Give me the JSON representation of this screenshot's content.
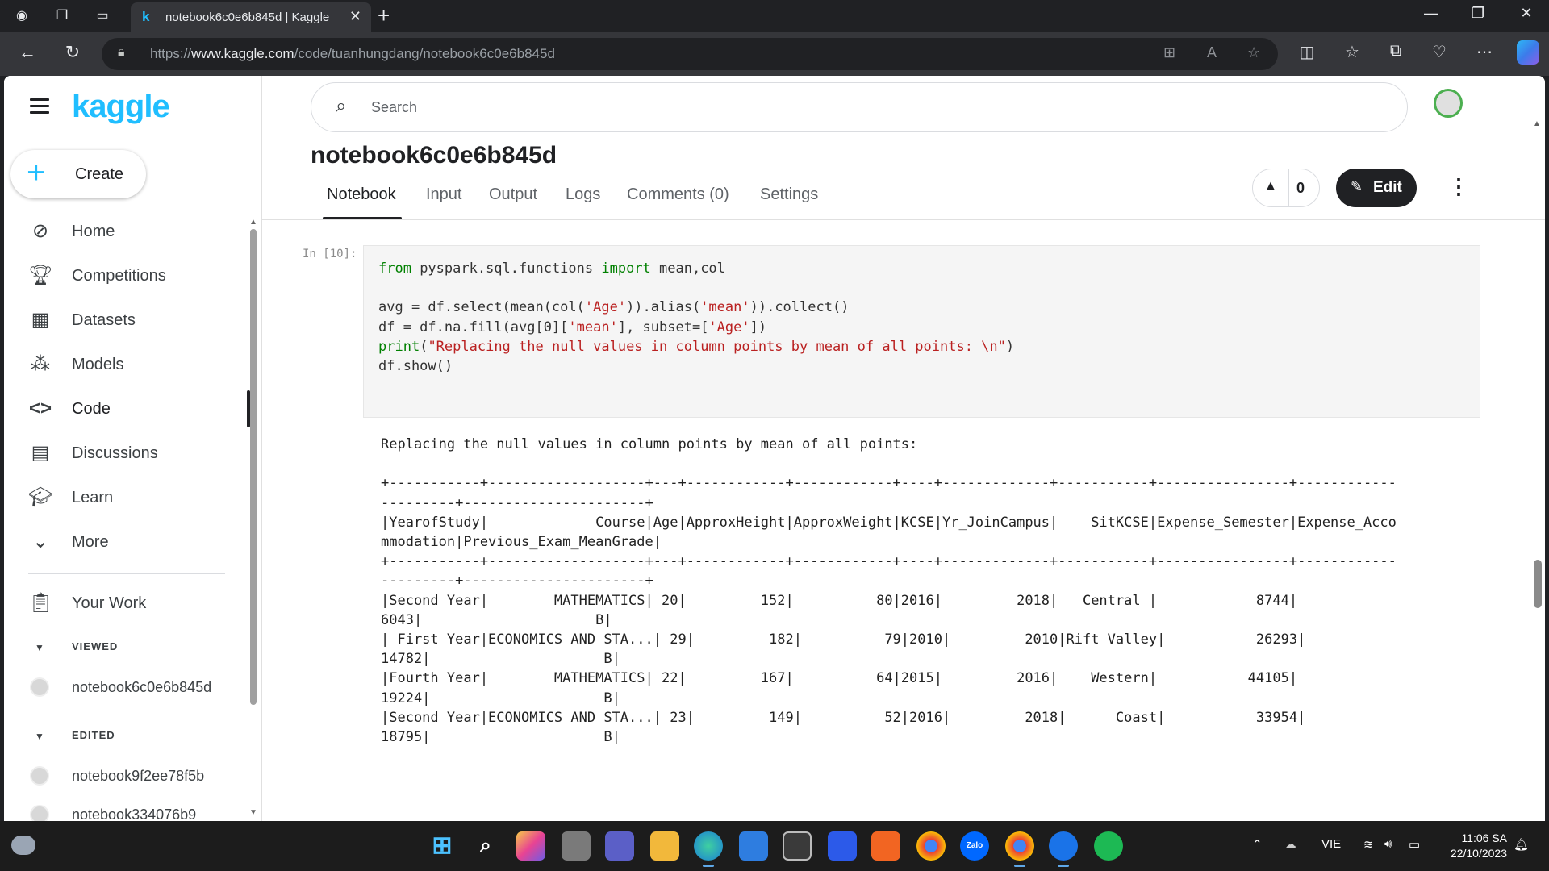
{
  "browser": {
    "tab_title": "notebook6c0e6b845d | Kaggle",
    "tab_favicon": "k",
    "url_prefix": "https://",
    "url_host": "www.kaggle.com",
    "url_path": "/code/tuanhungdang/notebook6c0e6b845d"
  },
  "sidebar": {
    "logo": "kaggle",
    "create_label": "Create",
    "nav": [
      {
        "label": "Home",
        "icon": "compass-icon"
      },
      {
        "label": "Competitions",
        "icon": "trophy-icon"
      },
      {
        "label": "Datasets",
        "icon": "table-icon"
      },
      {
        "label": "Models",
        "icon": "models-icon"
      },
      {
        "label": "Code",
        "icon": "code-icon"
      },
      {
        "label": "Discussions",
        "icon": "discussions-icon"
      },
      {
        "label": "Learn",
        "icon": "graduation-cap-icon"
      },
      {
        "label": "More",
        "icon": "chevron-down-icon"
      }
    ],
    "your_work": "Your Work",
    "viewed_header": "VIEWED",
    "viewed_item": "notebook6c0e6b845d",
    "edited_header": "EDITED",
    "edited_items": [
      "notebook9f2ee78f5b",
      "notebook334076b9"
    ]
  },
  "main": {
    "search_placeholder": "Search",
    "title": "notebook6c0e6b845d",
    "tabs": [
      "Notebook",
      "Input",
      "Output",
      "Logs",
      "Comments (0)",
      "Settings"
    ],
    "vote_count": "0",
    "edit_label": "Edit"
  },
  "cell": {
    "prompt": "In [10]:",
    "code_lines": [
      "from pyspark.sql.functions import mean,col",
      "",
      "avg = df.select(mean(col('Age')).alias('mean')).collect()",
      "df = df.na.fill(avg[0]['mean'], subset=['Age'])",
      "print(\"Replacing the null values in column points by mean of all points: \\n\")",
      "df.show()"
    ],
    "output": "Replacing the null values in column points by mean of all points: \n\n+-----------+-------------------+---+------------+------------+----+-------------+-----------+----------------+------------\n---------+----------------------+\n|YearofStudy|             Course|Age|ApproxHeight|ApproxWeight|KCSE|Yr_JoinCampus|    SitKCSE|Expense_Semester|Expense_Acco\nmmodation|Previous_Exam_MeanGrade|\n+-----------+-------------------+---+------------+------------+----+-------------+-----------+----------------+------------\n---------+----------------------+\n|Second Year|        MATHEMATICS| 20|         152|          80|2016|         2018|   Central |            8744|\n6043|                     B|\n| First Year|ECONOMICS AND STA...| 29|         182|          79|2010|         2010|Rift Valley|           26293|\n14782|                     B|\n|Fourth Year|        MATHEMATICS| 22|         167|          64|2015|         2016|    Western|           44105|\n19224|                     B|\n|Second Year|ECONOMICS AND STA...| 23|         149|          52|2016|         2018|      Coast|           33954|\n18795|                     B|"
  },
  "taskbar": {
    "lang": "VIE",
    "time": "11:06 SA",
    "date": "22/10/2023"
  }
}
